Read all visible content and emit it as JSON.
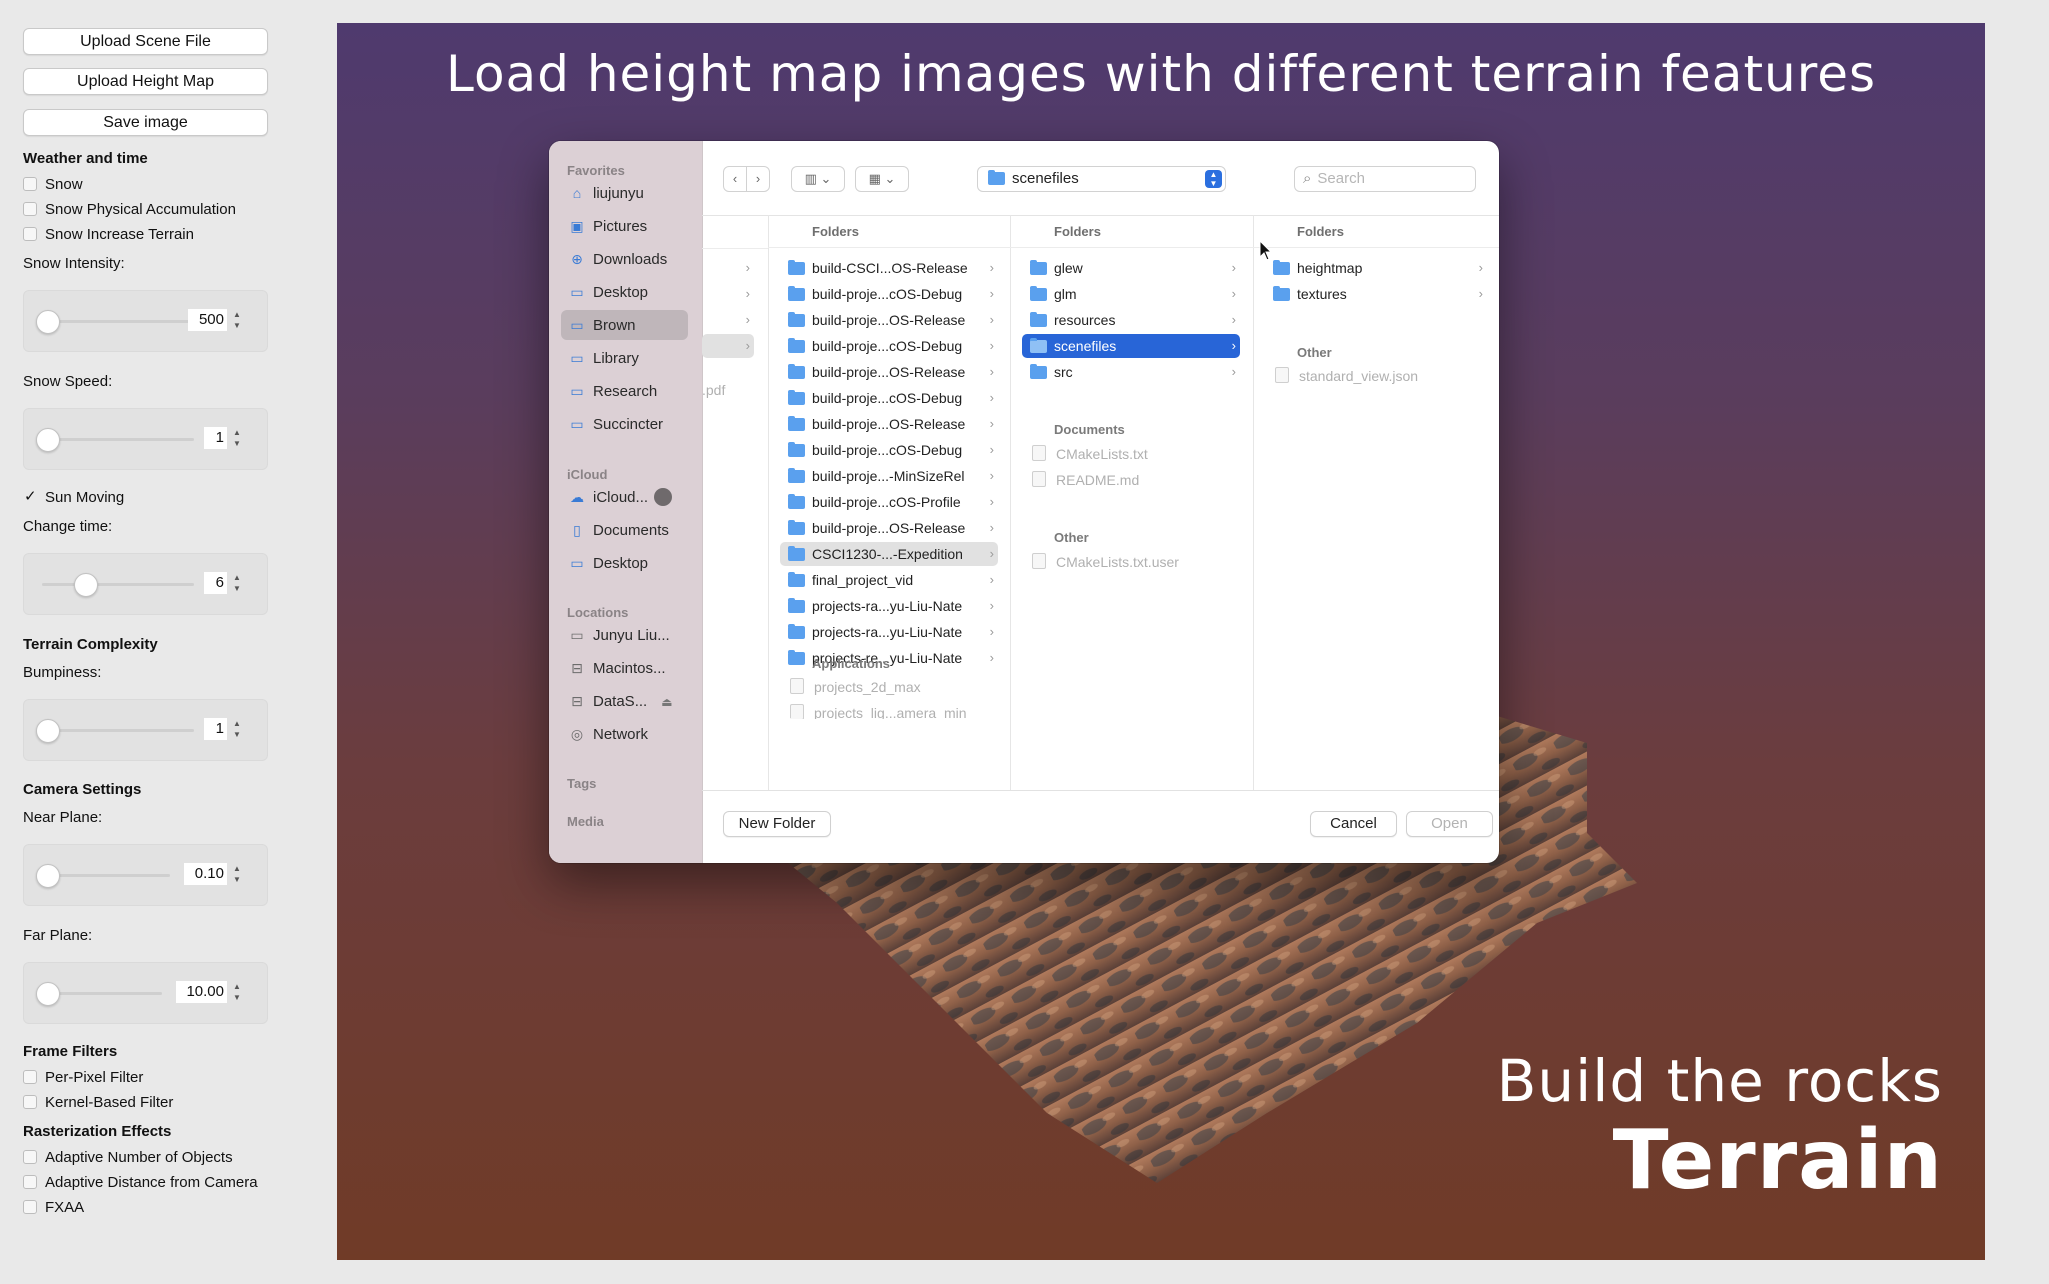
{
  "panel": {
    "buttons": [
      "Upload Scene File",
      "Upload Height Map",
      "Save image"
    ],
    "weather_heading": "Weather and time",
    "snow": "Snow",
    "snow_accum": "Snow Physical Accumulation",
    "snow_terrain": "Snow Increase Terrain",
    "snow_intensity_label": "Snow Intensity:",
    "snow_intensity_value": "500",
    "snow_speed_label": "Snow Speed:",
    "snow_speed_value": "1",
    "sun_moving": "Sun Moving",
    "change_time_label": "Change time:",
    "change_time_value": "6",
    "terrain_heading": "Terrain Complexity",
    "bumpiness_label": "Bumpiness:",
    "bumpiness_value": "1",
    "camera_heading": "Camera Settings",
    "near_label": "Near Plane:",
    "near_value": "0.10",
    "far_label": "Far Plane:",
    "far_value": "10.00",
    "filters_heading": "Frame Filters",
    "per_pixel": "Per-Pixel Filter",
    "kernel": "Kernel-Based Filter",
    "raster_heading": "Rasterization Effects",
    "adaptive_objects": "Adaptive Number of Objects",
    "adaptive_distance": "Adaptive Distance from Camera",
    "fxaa": "FXAA"
  },
  "render": {
    "title": "Load height map images with different terrain features",
    "subtitle": "Build the rocks",
    "subtitle_big": "Terrain"
  },
  "dialog": {
    "favorites_head": "Favorites",
    "favorites": [
      "liujunyu",
      "Pictures",
      "Downloads",
      "Desktop",
      "Brown",
      "Library",
      "Research",
      "Succincter"
    ],
    "icloud_head": "iCloud",
    "icloud": [
      "iCloud...",
      "Documents",
      "Desktop"
    ],
    "locations_head": "Locations",
    "locations": [
      "Junyu Liu...",
      "Macintos...",
      "DataS...",
      "Network"
    ],
    "tags_head": "Tags",
    "media_head": "Media",
    "path": "scenefiles",
    "search_placeholder": "Search",
    "col0_partial": ".pdf",
    "col1_head": "Folders",
    "col1_items": [
      "build-CSCI...OS-Release",
      "build-proje...cOS-Debug",
      "build-proje...OS-Release",
      "build-proje...cOS-Debug",
      "build-proje...OS-Release",
      "build-proje...cOS-Debug",
      "build-proje...OS-Release",
      "build-proje...cOS-Debug",
      "build-proje...-MinSizeRel",
      "build-proje...cOS-Profile",
      "build-proje...OS-Release",
      "CSCI1230-...-Expedition",
      "final_project_vid",
      "projects-ra...yu-Liu-Nate",
      "projects-ra...yu-Liu-Nate",
      "projects-re...yu-Liu-Nate"
    ],
    "col1_apps_head": "Applications",
    "col1_apps": [
      "projects_2d_max",
      "projects_lig...amera_min"
    ],
    "col2_head": "Folders",
    "col2_items": [
      "glew",
      "glm",
      "resources",
      "scenefiles",
      "src"
    ],
    "col2_docs_head": "Documents",
    "col2_docs": [
      "CMakeLists.txt",
      "README.md"
    ],
    "col2_other_head": "Other",
    "col2_other": [
      "CMakeLists.txt.user"
    ],
    "col3_head": "Folders",
    "col3_items": [
      "heightmap",
      "textures"
    ],
    "col3_other_head": "Other",
    "col3_other": [
      "standard_view.json"
    ],
    "new_folder": "New Folder",
    "cancel": "Cancel",
    "open": "Open"
  },
  "colors": {
    "accent": "#2865d7",
    "folder": "#5aa0ee",
    "sidebar": "#dcd0d5"
  }
}
